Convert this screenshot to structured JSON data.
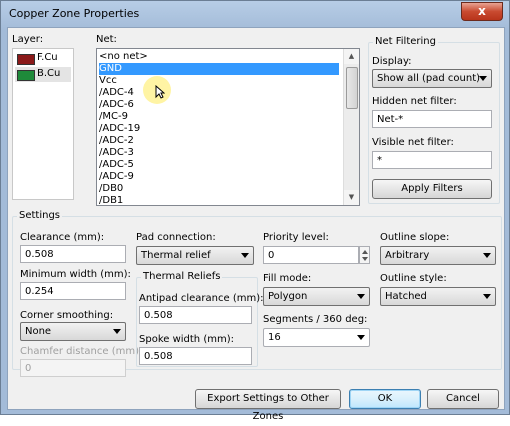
{
  "window": {
    "title": "Copper Zone Properties",
    "close_label": "x"
  },
  "layer": {
    "label": "Layer:",
    "items": [
      {
        "name": "F.Cu",
        "color": "#8b1a1a"
      },
      {
        "name": "B.Cu",
        "color": "#1e8a3a"
      }
    ]
  },
  "net": {
    "label": "Net:",
    "items": [
      "<no net>",
      "GND",
      "Vcc",
      "/ADC-4",
      "/ADC-6",
      "/MC-9",
      "/ADC-19",
      "/ADC-2",
      "/ADC-3",
      "/ADC-5",
      "/ADC-9",
      "/DB0",
      "/DB1"
    ],
    "selected_index": 1
  },
  "net_filtering": {
    "title": "Net Filtering",
    "display_label": "Display:",
    "display_value": "Show all (pad count)",
    "hidden_label": "Hidden net filter:",
    "hidden_value": "Net-*",
    "visible_label": "Visible net filter:",
    "visible_value": "*",
    "apply_label": "Apply Filters"
  },
  "settings": {
    "title": "Settings",
    "clearance_label": "Clearance (mm):",
    "clearance_value": "0.508",
    "min_width_label": "Minimum width (mm):",
    "min_width_value": "0.254",
    "corner_label": "Corner smoothing:",
    "corner_value": "None",
    "chamfer_label": "Chamfer distance (mm):",
    "chamfer_value": "0",
    "pad_label": "Pad connection:",
    "pad_value": "Thermal relief",
    "thermal_title": "Thermal Reliefs",
    "antipad_label": "Antipad clearance (mm):",
    "antipad_value": "0.508",
    "spoke_label": "Spoke width (mm):",
    "spoke_value": "0.508",
    "priority_label": "Priority level:",
    "priority_value": "0",
    "fill_label": "Fill mode:",
    "fill_value": "Polygon",
    "segments_label": "Segments / 360 deg:",
    "segments_value": "16",
    "slope_label": "Outline slope:",
    "slope_value": "Arbitrary",
    "style_label": "Outline style:",
    "style_value": "Hatched"
  },
  "footer": {
    "export_label": "Export Settings to Other Zones",
    "ok_label": "OK",
    "cancel_label": "Cancel"
  }
}
